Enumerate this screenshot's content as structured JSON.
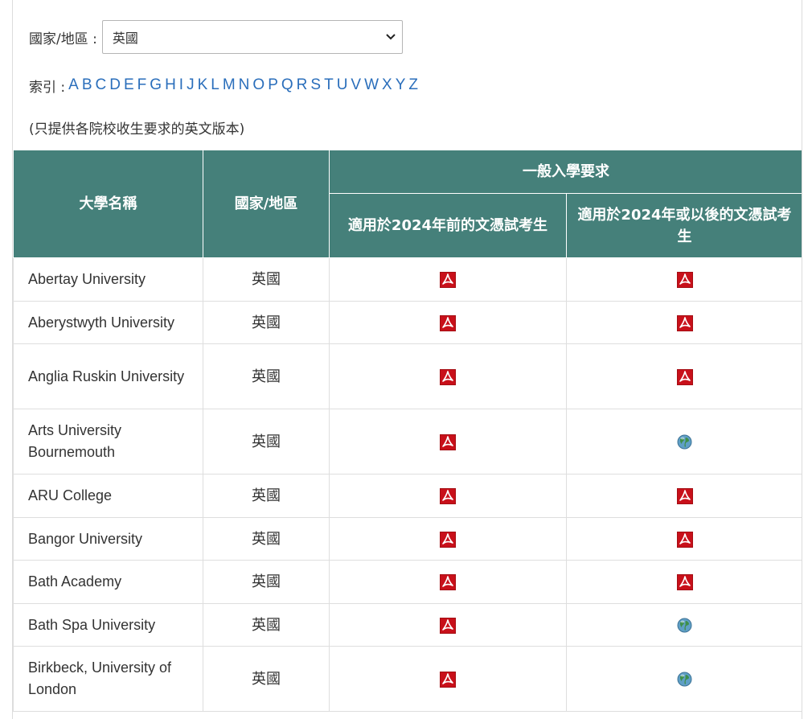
{
  "filter": {
    "label": "國家/地區 :",
    "selected": "英國"
  },
  "index": {
    "label": "索引 :",
    "letters": [
      "A",
      "B",
      "C",
      "D",
      "E",
      "F",
      "G",
      "H",
      "I",
      "J",
      "K",
      "L",
      "M",
      "N",
      "O",
      "P",
      "Q",
      "R",
      "S",
      "T",
      "U",
      "V",
      "W",
      "X",
      "Y",
      "Z"
    ]
  },
  "note": "(只提供各院校收生要求的英文版本)",
  "table": {
    "headers": {
      "university": "大學名稱",
      "country": "國家/地區",
      "general": "一般入學要求",
      "before_2024": "適用於2024年前的文憑試考生",
      "from_2024": "適用於2024年或以後的文憑試考生"
    },
    "rows": [
      {
        "name": "Abertay University",
        "country": "英國",
        "before": "pdf",
        "after": "pdf"
      },
      {
        "name": "Aberystwyth University",
        "country": "英國",
        "before": "pdf",
        "after": "pdf"
      },
      {
        "name": "Anglia Ruskin University",
        "country": "英國",
        "before": "pdf",
        "after": "pdf"
      },
      {
        "name": "Arts University Bournemouth",
        "country": "英國",
        "before": "pdf",
        "after": "globe"
      },
      {
        "name": "ARU College",
        "country": "英國",
        "before": "pdf",
        "after": "pdf"
      },
      {
        "name": "Bangor University",
        "country": "英國",
        "before": "pdf",
        "after": "pdf"
      },
      {
        "name": "Bath Academy",
        "country": "英國",
        "before": "pdf",
        "after": "pdf"
      },
      {
        "name": "Bath Spa University",
        "country": "英國",
        "before": "pdf",
        "after": "globe"
      },
      {
        "name": "Birkbeck, University of London",
        "country": "英國",
        "before": "pdf",
        "after": "globe"
      }
    ]
  },
  "icons": {
    "pdf": "pdf-icon",
    "globe": "globe-icon"
  },
  "colors": {
    "header_bg": "#45807a",
    "link": "#2a6ebb",
    "pdf_red": "#c8101a"
  }
}
